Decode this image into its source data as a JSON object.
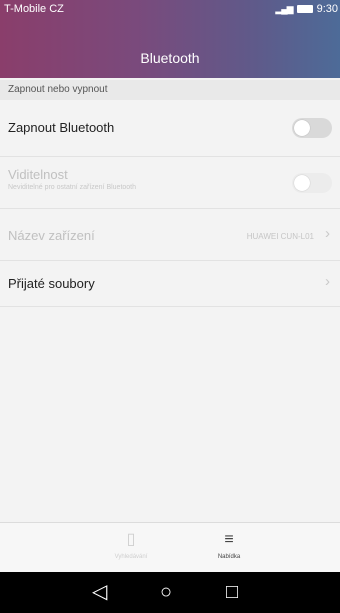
{
  "status_bar": {
    "carrier": "T-Mobile CZ",
    "time": "9:30"
  },
  "header": {
    "title": "Bluetooth"
  },
  "section": {
    "label": "Zapnout nebo vypnout"
  },
  "rows": {
    "bluetooth": {
      "label": "Zapnout Bluetooth",
      "state": "off"
    },
    "visibility": {
      "label": "Viditelnost",
      "sub": "Neviditelné pro ostatní zařízení Bluetooth",
      "state": "off",
      "enabled": false
    },
    "device_name": {
      "label": "Název zařízení",
      "value": "HUAWEI CUN-L01",
      "enabled": false
    },
    "received_files": {
      "label": "Přijaté soubory"
    }
  },
  "bottom_tabs": [
    {
      "label": "Vyhledávání",
      "icon": "search-device-icon",
      "enabled": false
    },
    {
      "label": "Nabídka",
      "icon": "menu-icon",
      "enabled": true
    }
  ],
  "nav": {
    "back": "back-icon",
    "home": "home-icon",
    "recents": "recents-icon"
  }
}
